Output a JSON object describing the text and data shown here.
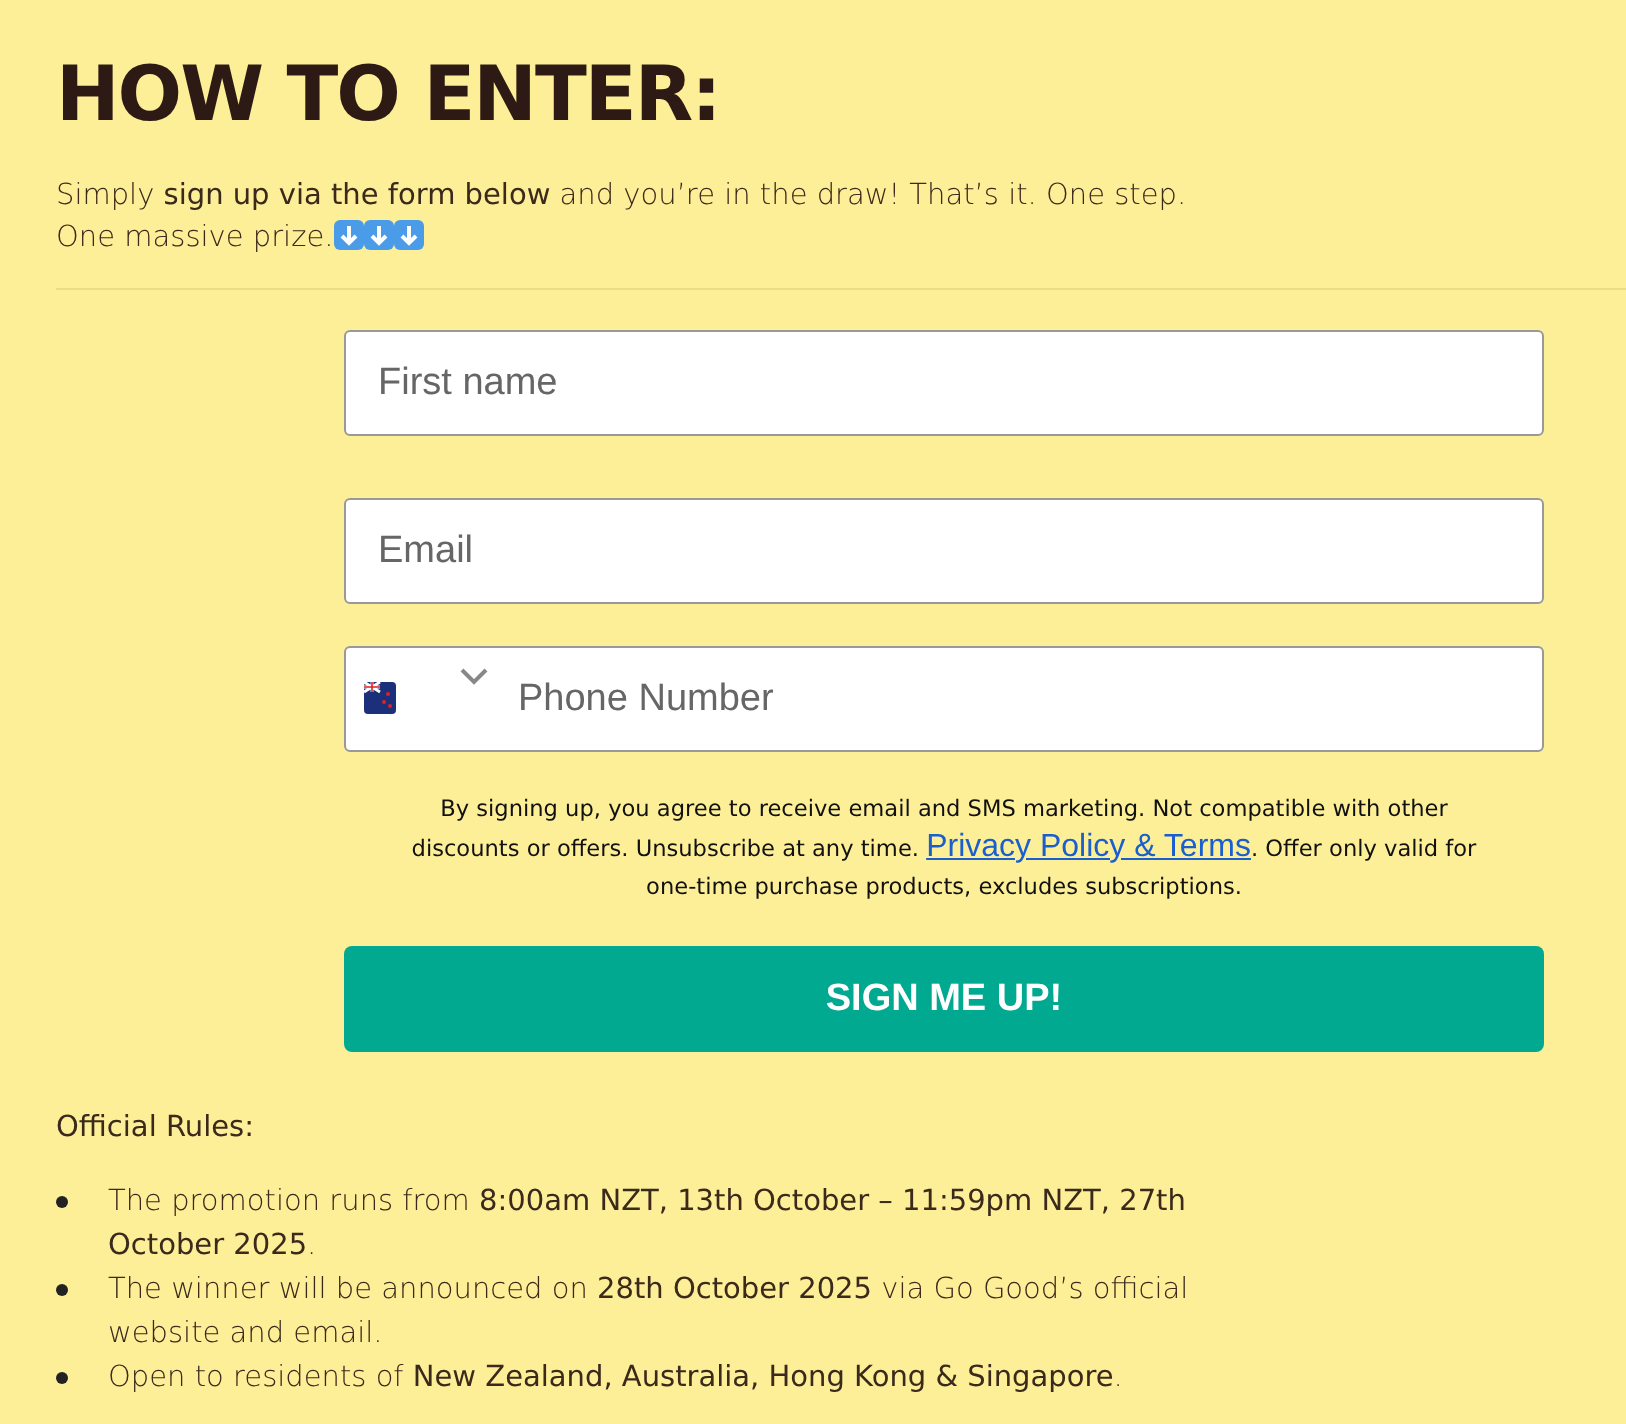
{
  "heading": "HOW TO ENTER:",
  "intro": "Simply **sign up via the form below** and you’re in the draw! That’s it. One step. One massive prize.",
  "form": {
    "fields": [
      {
        "kind": "text",
        "placeholder": "First name"
      },
      {
        "kind": "text",
        "placeholder": "Email"
      },
      {
        "kind": "phone",
        "placeholder": "Phone Number"
      }
    ],
    "disclaimer": {
      "before": "By signing up, you agree to receive email and SMS marketing. Not compatible with other discounts or offers. Unsubscribe at any time.",
      "link": "Privacy Policy & Terms",
      "after": ". Offer only valid for one-time purchase products, excludes subscriptions."
    },
    "submit": "SIGN ME UP!"
  },
  "rules": {
    "title": "Official Rules:",
    "items": [
      "The promotion runs from **8:00am NZT, 13th October – 11:59pm NZT, 27th October 2025**.",
      "The winner will be announced on **28th October 2025** via Go Good’s official website and email.",
      "Open to residents of **New Zealand, Australia, Hong Kong & Singapore**."
    ]
  }
}
